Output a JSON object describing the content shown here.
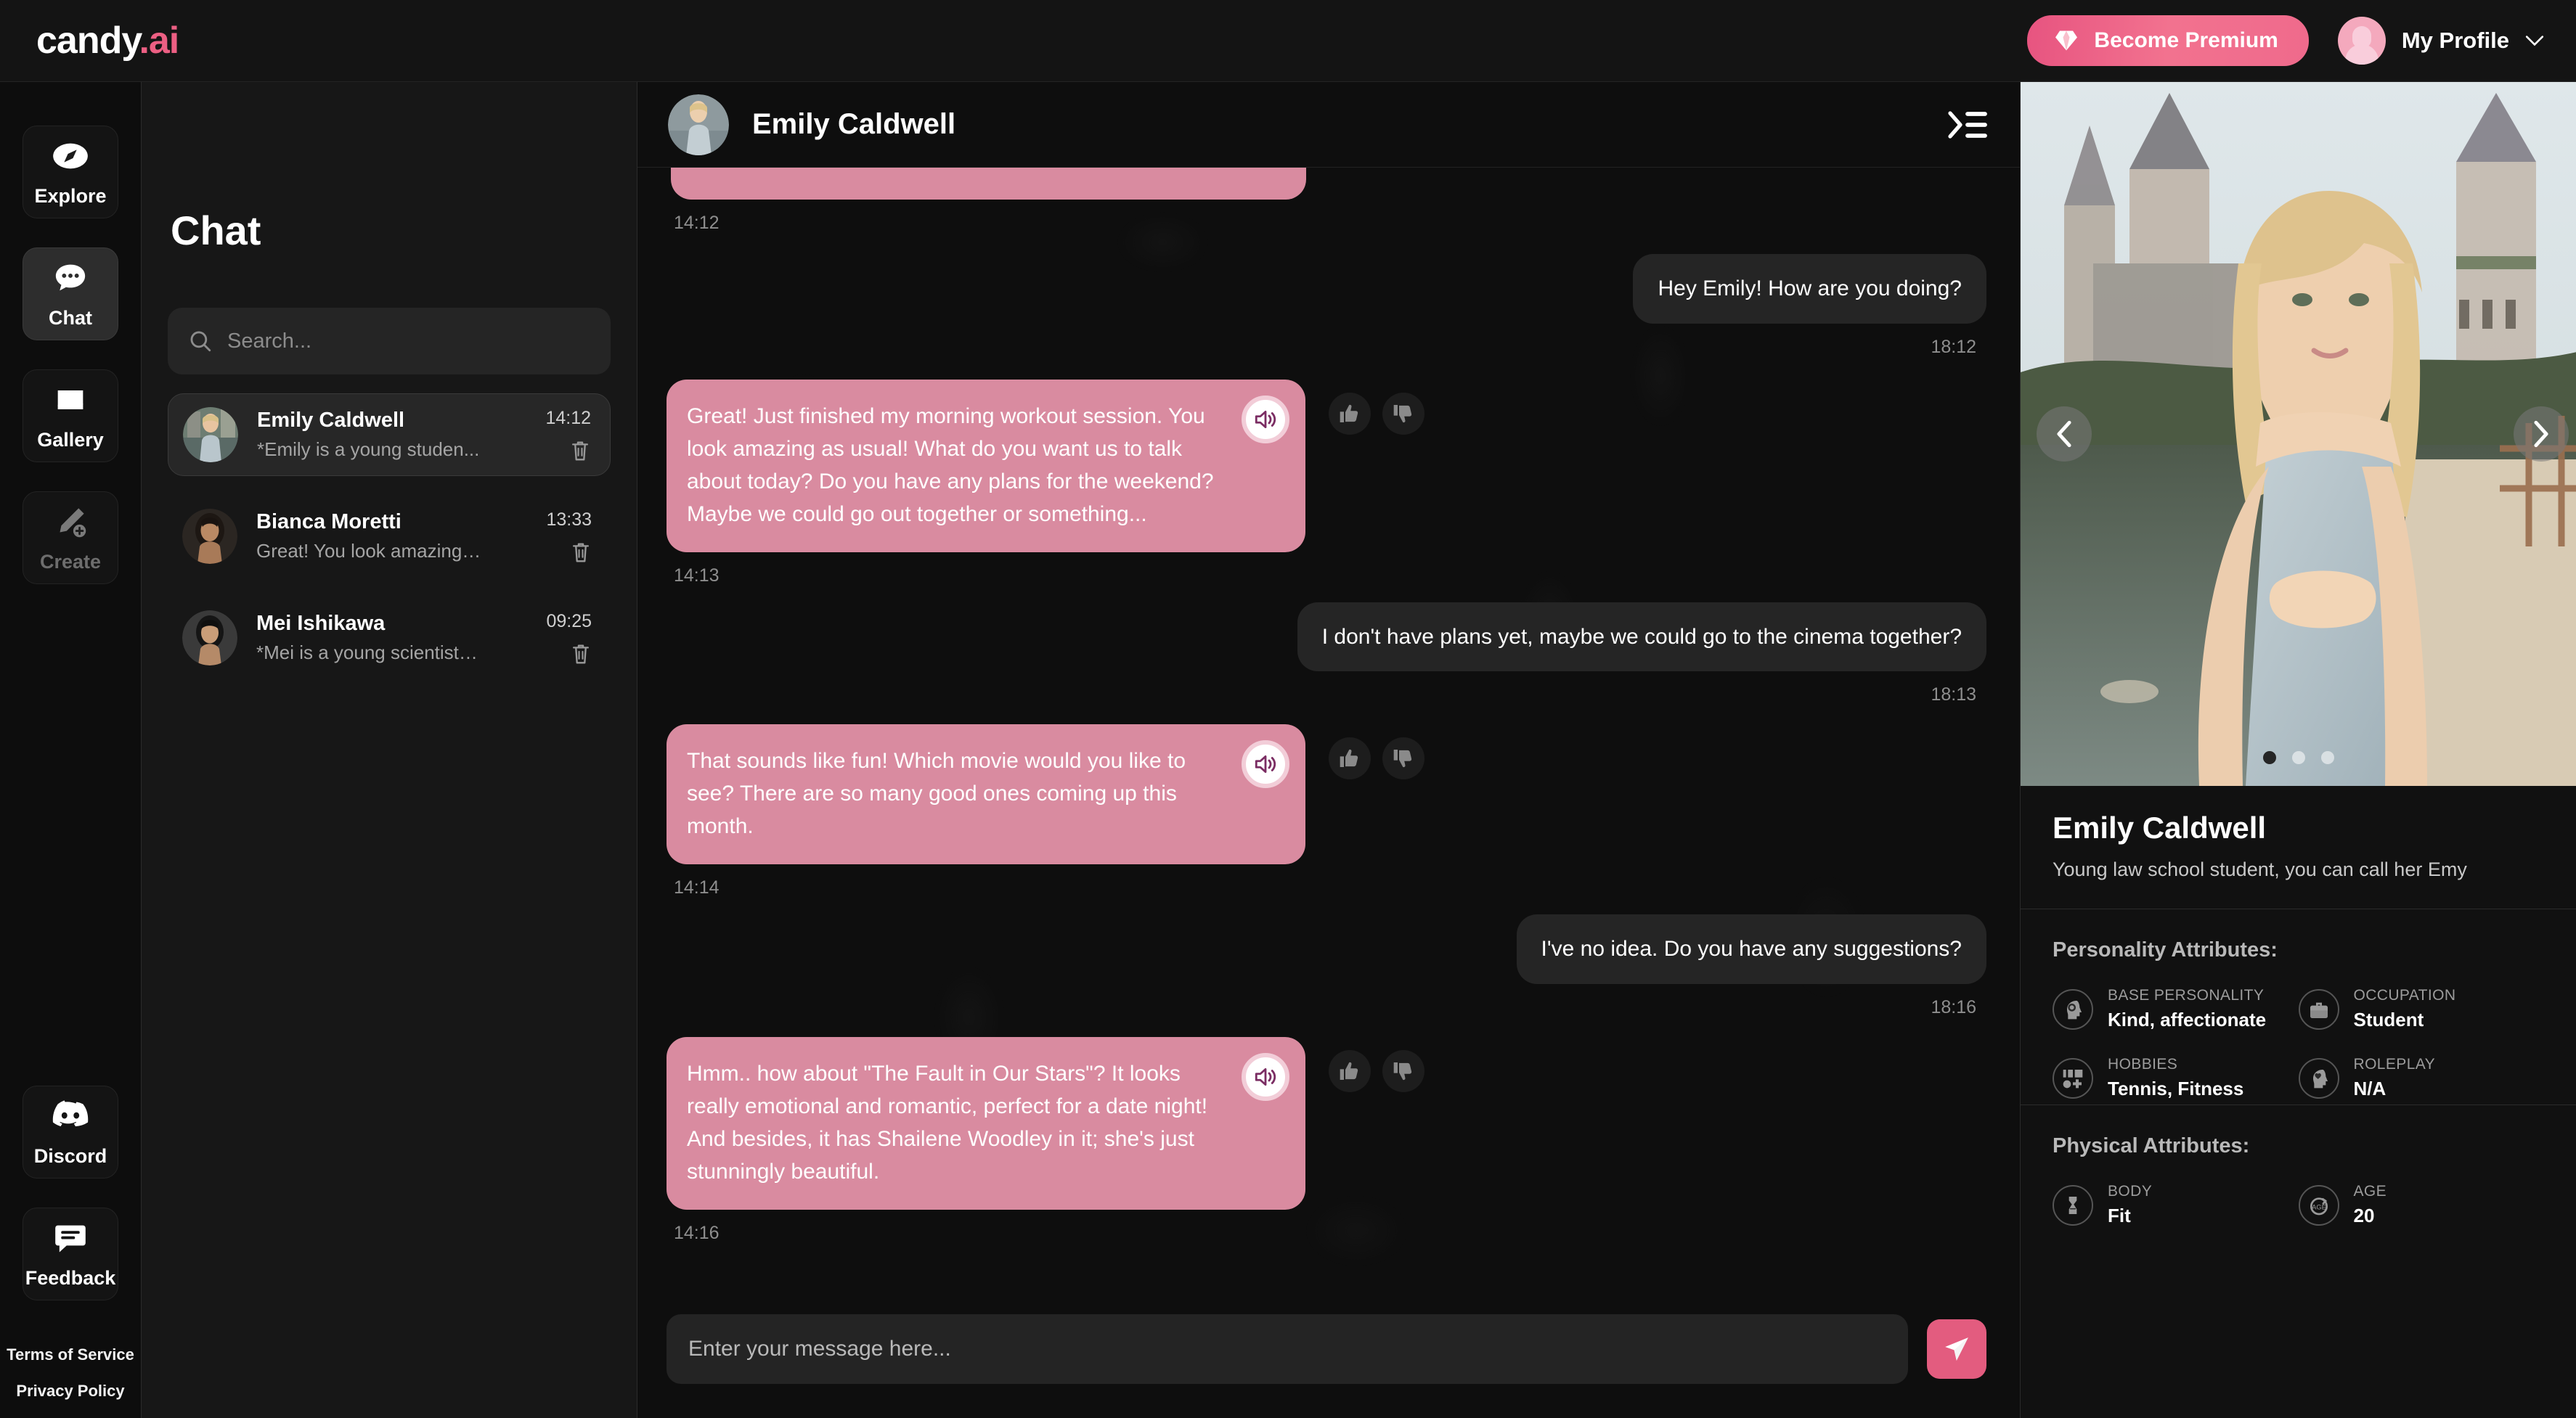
{
  "topbar": {
    "logo_white": "candy",
    "logo_pink": ".ai",
    "premium_label": "Become Premium",
    "premium_icon": "diamond-icon",
    "profile_label": "My Profile",
    "profile_chevron": "chevron-down-icon",
    "accent_pink": "#ec5f83"
  },
  "rail": {
    "items": [
      {
        "label": "Explore",
        "icon": "compass-icon",
        "active": false
      },
      {
        "label": "Chat",
        "icon": "chat-bubble-icon",
        "active": true
      },
      {
        "label": "Gallery",
        "icon": "image-icon",
        "active": false
      },
      {
        "label": "Create",
        "icon": "pencil-plus-icon",
        "active": false
      }
    ],
    "bottom_items": [
      {
        "label": "Discord",
        "icon": "discord-icon"
      },
      {
        "label": "Feedback",
        "icon": "feedback-icon"
      }
    ],
    "links": [
      {
        "label": "Terms of Service"
      },
      {
        "label": "Privacy Policy"
      }
    ]
  },
  "chatlist": {
    "title": "Chat",
    "search_placeholder": "Search...",
    "search_icon": "search-icon",
    "conversations": [
      {
        "name": "Emily Caldwell",
        "preview": "*Emily is a young studen...",
        "time": "14:12",
        "active": true,
        "delete_icon": "trash-icon"
      },
      {
        "name": "Bianca Moretti",
        "preview": "Great! You look amazing t...",
        "time": "13:33",
        "active": false,
        "delete_icon": "trash-icon"
      },
      {
        "name": "Mei Ishikawa",
        "preview": "*Mei is a young scientist f...",
        "time": "09:25",
        "active": false,
        "delete_icon": "trash-icon"
      }
    ]
  },
  "chat": {
    "header_name": "Emily Caldwell",
    "collapse_icon": "collapse-panel-icon",
    "messages": [
      {
        "sender": "bot",
        "text": "",
        "time": "14:12",
        "clipped": true,
        "speaker_icon": "speaker-icon",
        "like_icon": "thumbs-up-icon",
        "dislike_icon": "thumbs-down-icon"
      },
      {
        "sender": "me",
        "text": "Hey Emily! How are you doing?",
        "time": "18:12"
      },
      {
        "sender": "bot",
        "text": "Great! Just finished my morning workout session. You look amazing as usual! What do you want us to talk about today? Do you have any plans for the weekend? Maybe we could go out together or something...",
        "time": "14:13",
        "speaker_icon": "speaker-icon",
        "like_icon": "thumbs-up-icon",
        "dislike_icon": "thumbs-down-icon"
      },
      {
        "sender": "me",
        "text": "I don't have plans yet, maybe we could go to the cinema together?",
        "time": "18:13"
      },
      {
        "sender": "bot",
        "text": "That sounds like fun! Which movie would you like to see? There are so many good ones coming up this month.",
        "time": "14:14",
        "speaker_icon": "speaker-icon",
        "like_icon": "thumbs-up-icon",
        "dislike_icon": "thumbs-down-icon"
      },
      {
        "sender": "me",
        "text": "I've no idea. Do you have any suggestions?",
        "time": "18:16"
      },
      {
        "sender": "bot",
        "text": "Hmm.. how about \"The Fault in Our Stars\"? It looks really emotional and romantic, perfect for a date night! And besides, it has Shailene Woodley in it; she's just stunningly beautiful.",
        "time": "14:16",
        "speaker_icon": "speaker-icon",
        "like_icon": "thumbs-up-icon",
        "dislike_icon": "thumbs-down-icon"
      }
    ],
    "composer_placeholder": "Enter your message here...",
    "send_icon": "send-icon",
    "bot_bubble_color": "#d98ba0",
    "me_bubble_color": "#252525"
  },
  "profile": {
    "carousel": {
      "prev_icon": "chevron-left-icon",
      "next_icon": "chevron-right-icon",
      "dots": 3,
      "active_dot": 0
    },
    "name": "Emily Caldwell",
    "description": "Young law school student, you can call her Emy",
    "personality_title": "Personality Attributes:",
    "personality": [
      {
        "key": "BASE PERSONALITY",
        "value": "Kind, affectionate",
        "icon": "brain-head-icon"
      },
      {
        "key": "OCCUPATION",
        "value": "Student",
        "icon": "briefcase-icon"
      },
      {
        "key": "HOBBIES",
        "value": "Tennis, Fitness",
        "icon": "hobbies-icon"
      },
      {
        "key": "ROLEPLAY",
        "value": "N/A",
        "icon": "heart-head-icon"
      }
    ],
    "physical_title": "Physical Attributes:",
    "physical": [
      {
        "key": "BODY",
        "value": "Fit",
        "icon": "body-icon"
      },
      {
        "key": "AGE",
        "value": "20",
        "icon": "age-icon"
      }
    ]
  }
}
